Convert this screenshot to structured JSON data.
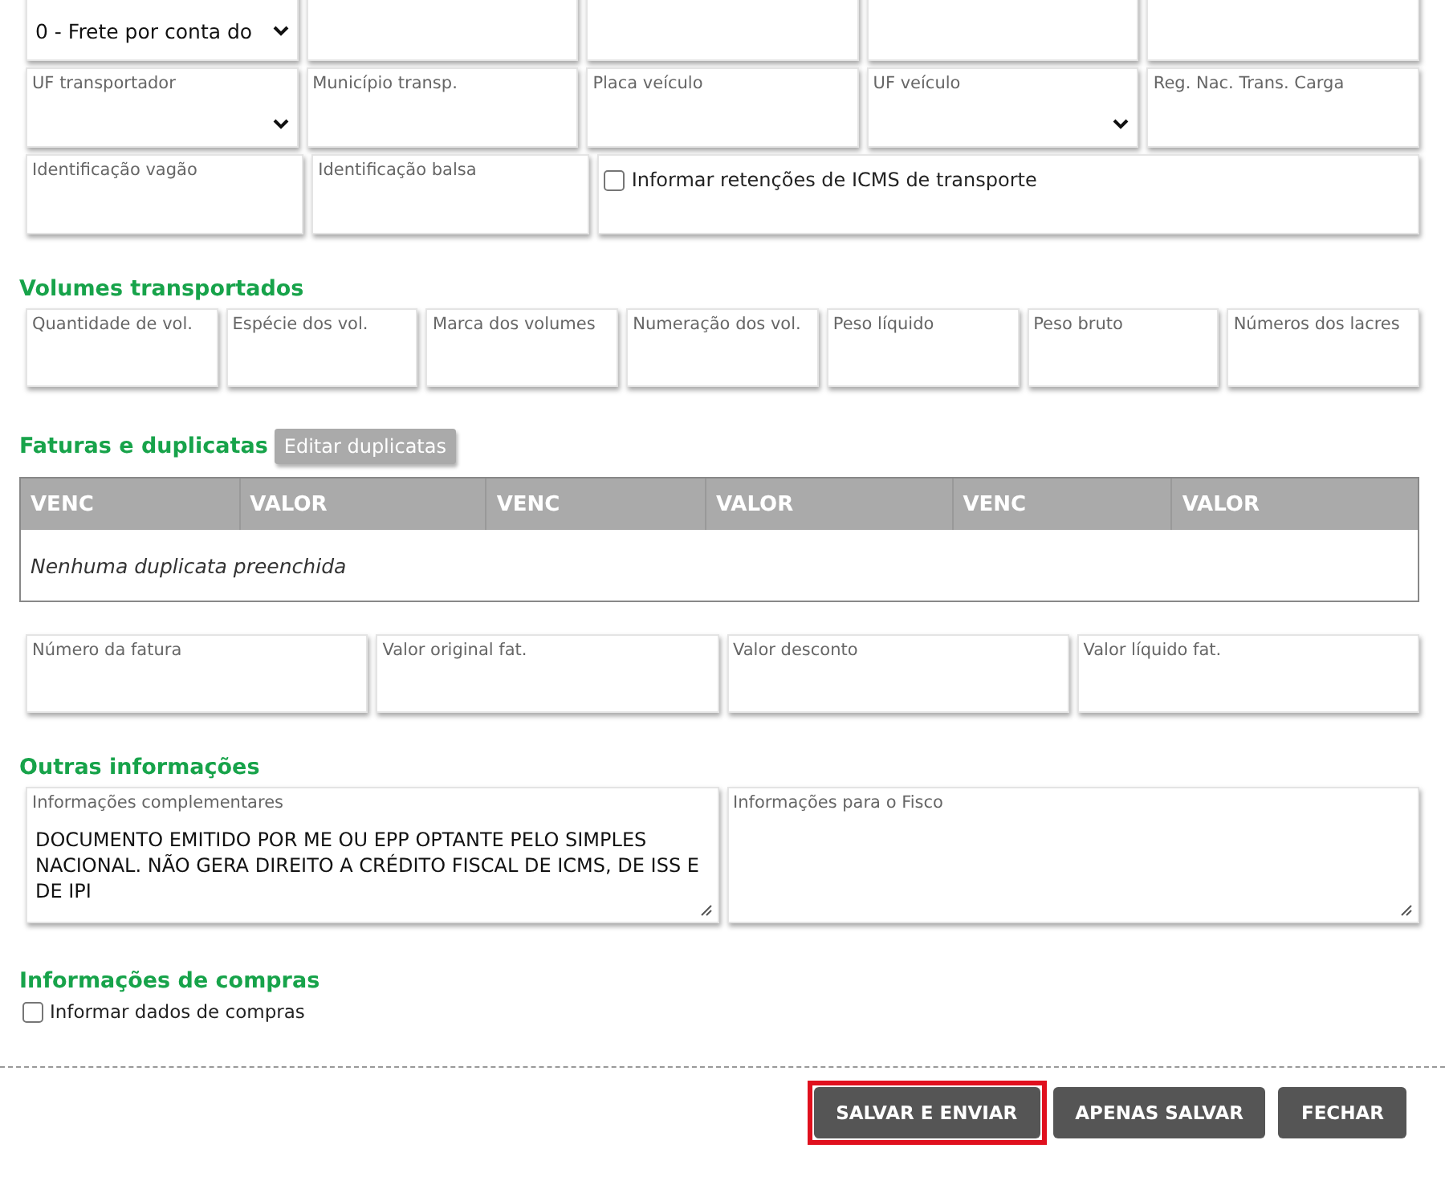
{
  "transport_rows": [
    [
      {
        "kind": "select",
        "value": "0 - Frete por conta do"
      },
      {
        "kind": "text"
      },
      {
        "kind": "text"
      },
      {
        "kind": "text"
      },
      {
        "kind": "text"
      }
    ],
    [
      {
        "kind": "select",
        "label": "UF transportador"
      },
      {
        "kind": "text",
        "label": "Município transp."
      },
      {
        "kind": "text",
        "label": "Placa veículo"
      },
      {
        "kind": "select",
        "label": "UF veículo"
      },
      {
        "kind": "text",
        "label": "Reg. Nac. Trans. Carga"
      }
    ],
    [
      {
        "kind": "text",
        "label": "Identificação vagão"
      },
      {
        "kind": "text",
        "label": "Identificação balsa"
      },
      {
        "kind": "checkbox",
        "label": "Informar retenções de ICMS de transporte",
        "checked": false
      }
    ]
  ],
  "volumes": {
    "title": "Volumes transportados",
    "fields": [
      "Quantidade de vol.",
      "Espécie dos vol.",
      "Marca dos volumes",
      "Numeração dos vol.",
      "Peso líquido",
      "Peso bruto",
      "Números dos lacres"
    ]
  },
  "invoices": {
    "title": "Faturas e duplicatas",
    "edit_button": "Editar duplicatas",
    "table": {
      "columns": [
        "VENC",
        "VALOR",
        "VENC",
        "VALOR",
        "VENC",
        "VALOR"
      ],
      "empty_text": "Nenhuma duplicata preenchida"
    },
    "fields": [
      "Número da fatura",
      "Valor original fat.",
      "Valor desconto",
      "Valor líquido fat."
    ]
  },
  "other": {
    "title": "Outras informações",
    "fields": [
      {
        "label": "Informações complementares",
        "value": "DOCUMENTO EMITIDO POR ME OU EPP OPTANTE PELO SIMPLES NACIONAL. NÃO GERA DIREITO A CRÉDITO FISCAL DE ICMS, DE ISS E DE IPI"
      },
      {
        "label": "Informações para o Fisco"
      }
    ]
  },
  "purchases": {
    "title": "Informações de compras",
    "checkbox": {
      "label": "Informar dados de compras",
      "checked": false
    }
  },
  "buttons": [
    {
      "label": "SALVAR E ENVIAR",
      "highlighted": true
    },
    {
      "label": "APENAS SALVAR",
      "highlighted": false
    },
    {
      "label": "FECHAR",
      "highlighted": false
    }
  ]
}
